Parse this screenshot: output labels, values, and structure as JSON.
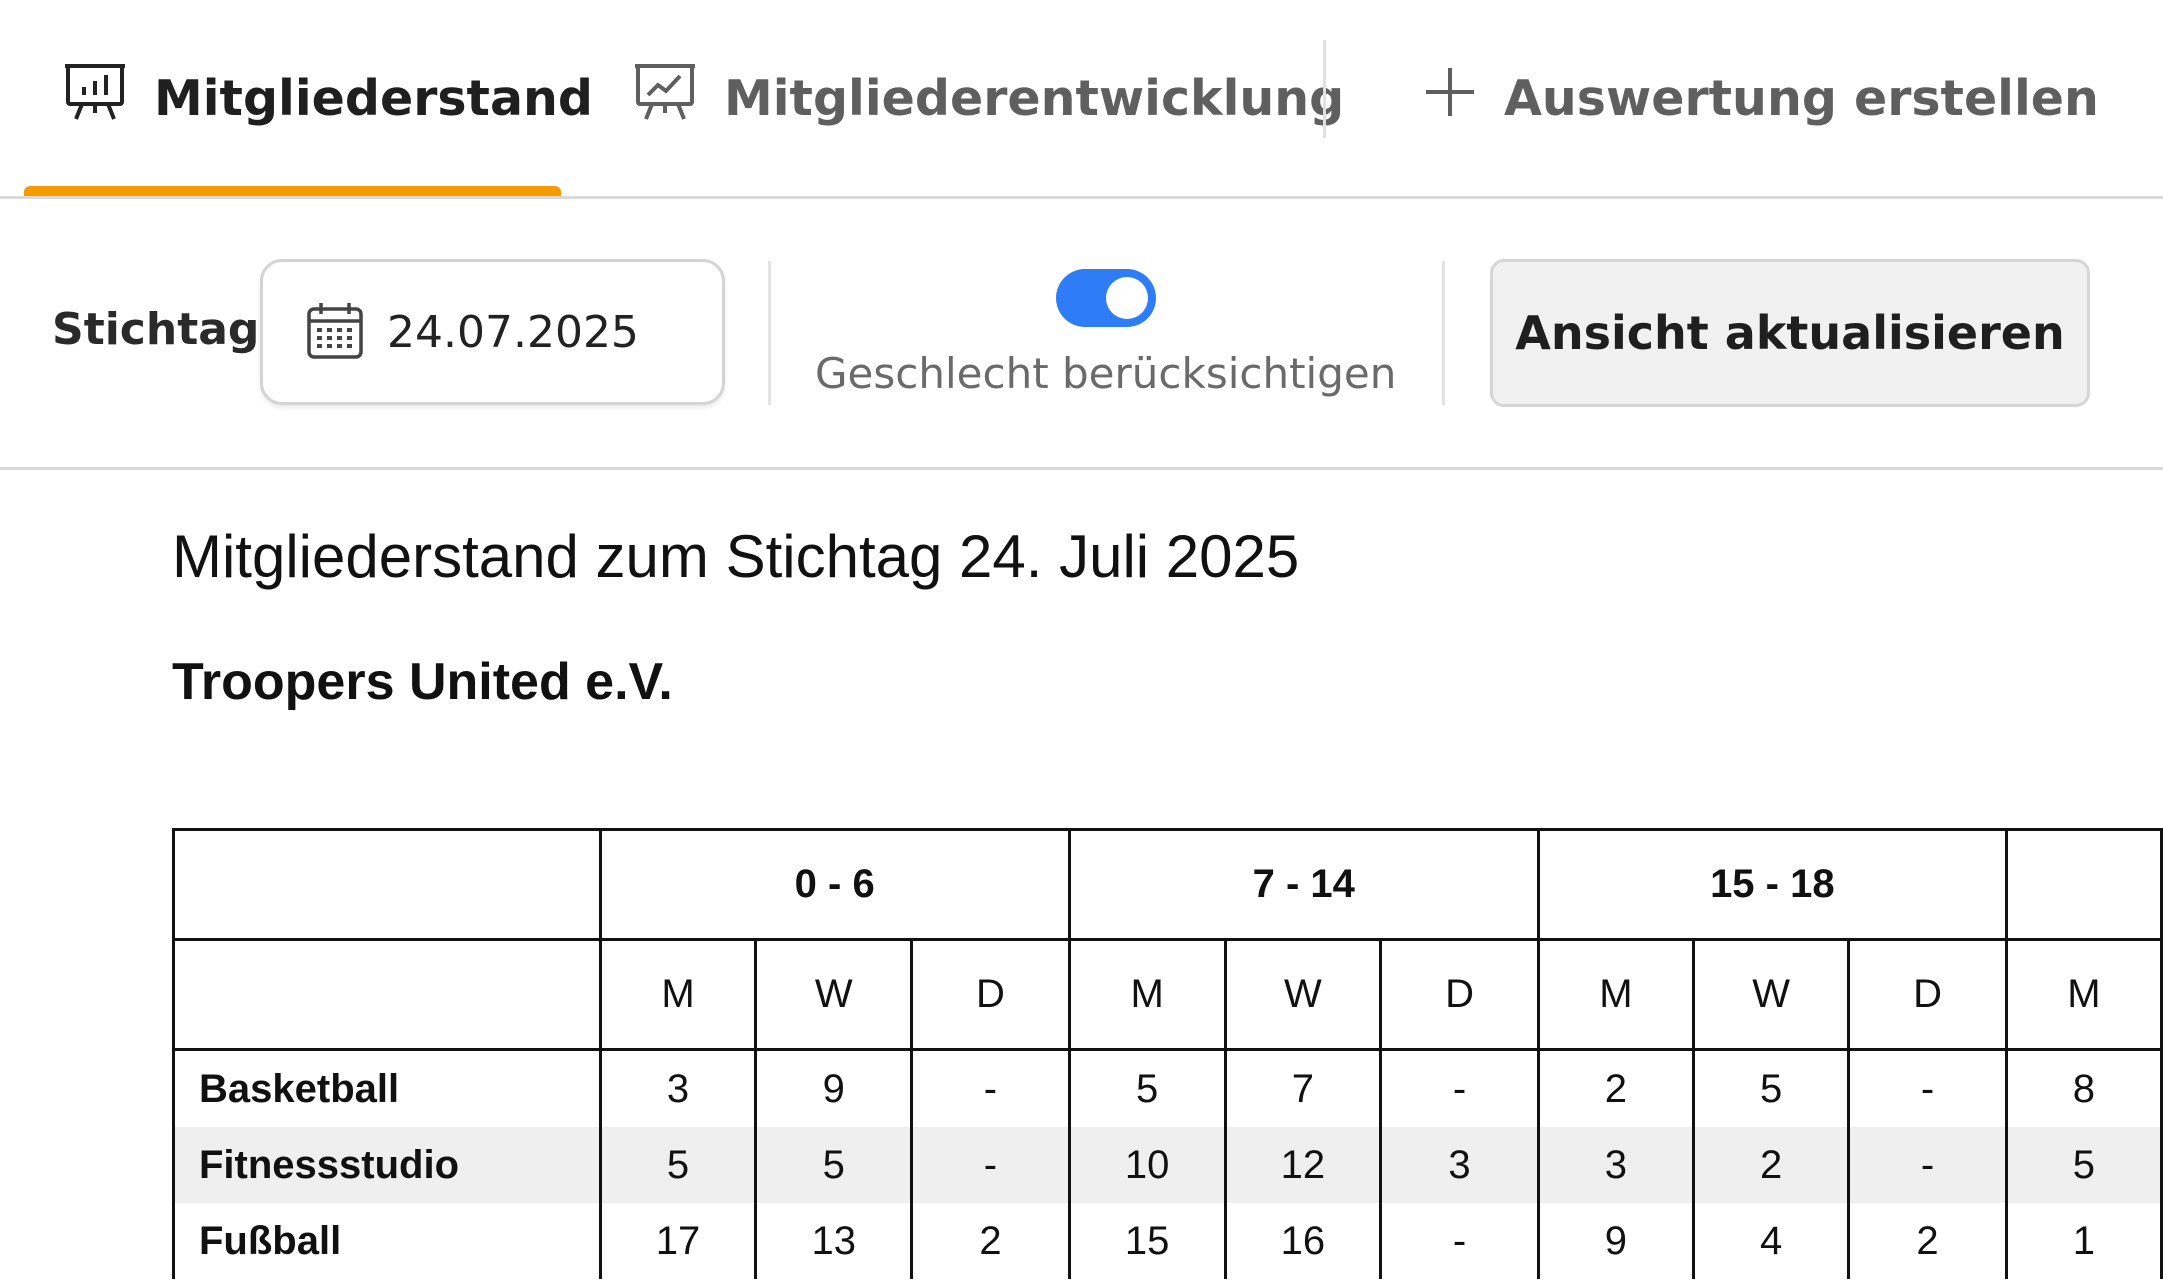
{
  "tabs": [
    {
      "label": "Mitgliederstand",
      "icon": "presentation-chart-icon",
      "active": true
    },
    {
      "label": "Mitgliederentwicklung",
      "icon": "trend-chart-icon",
      "active": false
    },
    {
      "label": "Auswertung erstellen",
      "icon": "plus-icon",
      "active": false
    }
  ],
  "toolbar": {
    "stichtag_label": "Stichtag",
    "date_value": "24.07.2025",
    "gender_toggle_label": "Geschlecht berücksichtigen",
    "gender_toggle_on": true,
    "refresh_button": "Ansicht aktualisieren"
  },
  "report": {
    "title": "Mitgliederstand zum Stichtag 24. Juli 2025",
    "club_name": "Troopers United e.V.",
    "age_groups": [
      "0 - 6",
      "7 - 14",
      "15 - 18",
      ""
    ],
    "gender_headers": [
      "M",
      "W",
      "D",
      "M",
      "W",
      "D",
      "M",
      "W",
      "D",
      "M"
    ],
    "rows": [
      {
        "name": "Basketball",
        "values": [
          "3",
          "9",
          "-",
          "5",
          "7",
          "-",
          "2",
          "5",
          "-",
          "8"
        ]
      },
      {
        "name": "Fitnessstudio",
        "values": [
          "5",
          "5",
          "-",
          "10",
          "12",
          "3",
          "3",
          "2",
          "-",
          "5"
        ]
      },
      {
        "name": "Fußball",
        "values": [
          "17",
          "13",
          "2",
          "15",
          "16",
          "-",
          "9",
          "4",
          "2",
          "1"
        ]
      }
    ]
  },
  "colors": {
    "accent": "#f59b00",
    "toggle": "#2f7df6",
    "row_shade": "#efefef"
  }
}
